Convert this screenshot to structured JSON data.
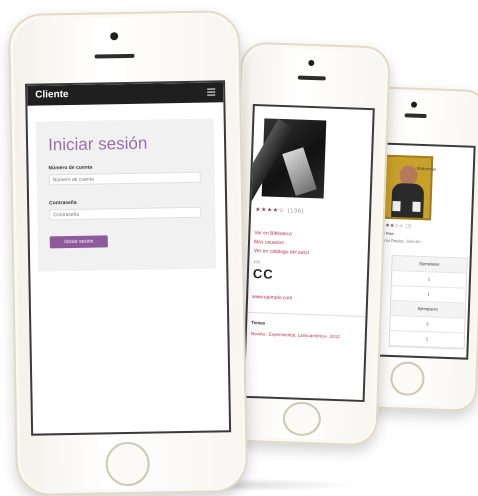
{
  "front_phone": {
    "app_title": "Cliente",
    "login": {
      "title": "Iniciar sesión",
      "username_label": "Número de cuenta",
      "username_placeholder": "Número de cuenta",
      "password_label": "Contraseña",
      "password_placeholder": "Contraseña",
      "submit_label": "Iniciar sesión"
    }
  },
  "middle_phone": {
    "rating_stars": "★★★★☆",
    "rating_count": "(136)",
    "links": [
      "Ver en Biblioteca",
      "Mas usuarios",
      "Ver en catálogo del autor"
    ],
    "code": "CC",
    "small_text": "100",
    "permalink": "www.ejemplo.com",
    "section_label": "Temas",
    "section_text": "Novela - Experimental, Latinoamérica - 2012"
  },
  "back_phone": {
    "tab_label": "Bibliotecas",
    "rating_stars": "★★★☆☆",
    "rating_count": "(3)",
    "author_line": "Le Fixe",
    "sub_line": "Tomo Reglas, Julio etc.",
    "table": {
      "header": "Ejemplares",
      "rows": [
        "1",
        "1",
        "Ejemplares",
        "2",
        "1"
      ]
    }
  }
}
